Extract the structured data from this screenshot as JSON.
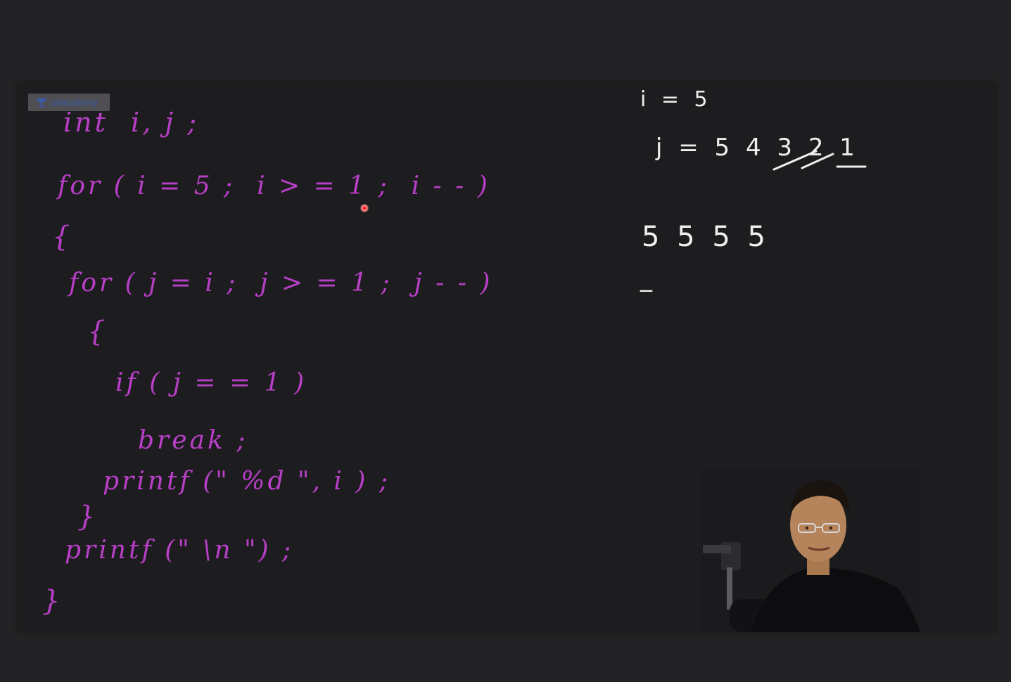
{
  "watermark": {
    "icon": "unacademy-logo-icon",
    "text": "unacademy"
  },
  "code_lines": [
    "int  i, j ;",
    "for ( i = 5 ;  i > = 1 ;  i - - )",
    "{",
    "for ( j = i ;  j > = 1 ;  j - - )",
    "{",
    "if ( j = = 1 )",
    "break ;",
    "printf (\" %d \", i ) ;",
    "}",
    "printf (\" \\n \") ;",
    "}"
  ],
  "notes": {
    "i_line": "i = 5",
    "j_line": "j = 5 4 3 2 1",
    "output_line": "5 5 5 5",
    "cursor_line": "_"
  },
  "colors": {
    "ink_code": "#b93fc8",
    "ink_notes": "#efefef",
    "board": "#1d1d1f",
    "laser": "#ff2a2a"
  },
  "webcam": {
    "icon": "presenter-webcam"
  }
}
